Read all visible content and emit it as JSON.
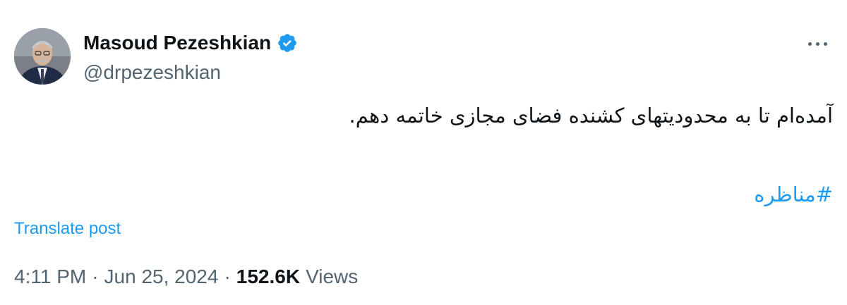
{
  "tweet": {
    "author": {
      "display_name": "Masoud Pezeshkian",
      "handle": "@drpezeshkian",
      "verified": true,
      "verified_color": "#1d9bf0"
    },
    "text": "آمده‌ام تا به محدودیتهای کشنده فضای مجازی خاتمه دهم.",
    "hashtag": "#مناظره",
    "translate_label": "Translate post",
    "time": "4:11 PM",
    "separator": "·",
    "date": "Jun 25, 2024",
    "views_count": "152.6K",
    "views_label": "Views",
    "more_icon": "more-horizontal-icon",
    "colors": {
      "link": "#1d9bf0",
      "secondary_text": "#536471",
      "primary_text": "#0f1419"
    }
  }
}
